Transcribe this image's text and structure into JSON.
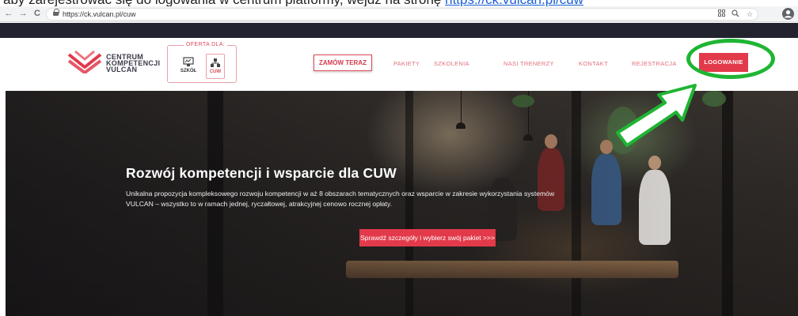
{
  "caption": {
    "text": "aby zarejestrować się do logowania w centrum platformy, wejdź na stronę",
    "link_text": "https://ck.vulcan.pl/cuw"
  },
  "browser": {
    "url": "https://ck.vulcan.pl/cuw",
    "back_glyph": "←",
    "forward_glyph": "→",
    "reload_glyph": "C",
    "icons": [
      "grid-icon",
      "zoom-icon",
      "star-icon",
      "profile-icon"
    ]
  },
  "header": {
    "logo": {
      "line1": "CENTRUM",
      "line2": "KOMPETENCJI",
      "line3": "VULCAN"
    },
    "offer": {
      "label": "OFERTA DLA:",
      "tiles": [
        {
          "label": "SZKÓŁ"
        },
        {
          "label": "CUW"
        }
      ]
    },
    "order_button": "ZAMÓW TERAZ",
    "nav": [
      "PAKIETY",
      "SZKOLENIA",
      "NASI TRENERZY",
      "KONTAKT",
      "REJESTRACJA"
    ],
    "login_button": "LOGOWANIE"
  },
  "hero": {
    "title": "Rozwój kompetencji i wsparcie dla CUW",
    "description": "Unikalna propozycja kompleksowego rozwoju kompetencji w aż 8 obszarach tematycznych oraz wsparcie w zakresie wykorzystania systemów VULCAN – wszystko to w ramach jednej, ryczałtowej, atrakcyjnej cenowo rocznej opłaty.",
    "cta": "Sprawdź szczegóły i wybierz swój pakiet >>>"
  },
  "colors": {
    "brand_red": "#e23a4a",
    "annotation_green": "#1fb533",
    "dark_band": "#232330"
  }
}
